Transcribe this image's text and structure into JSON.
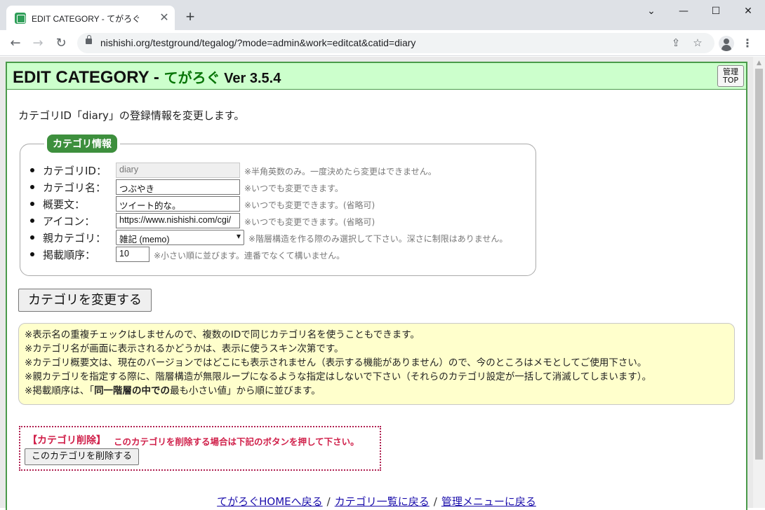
{
  "browser": {
    "tab_title": "EDIT CATEGORY - てがろぐ",
    "url": "nishishi.org/testground/tegalog/?mode=admin&work=editcat&catid=diary"
  },
  "header": {
    "title_main": "EDIT CATEGORY - ",
    "title_app": "てがろぐ",
    "title_version": " Ver 3.5.4",
    "admin_button_line1": "管理",
    "admin_button_line2": "TOP"
  },
  "intro": "カテゴリID「diary」の登録情報を変更します。",
  "form": {
    "legend": "カテゴリ情報",
    "fields": [
      {
        "label": "カテゴリID：",
        "value": "diary",
        "note": "※半角英数のみ。一度決めたら変更はできません。"
      },
      {
        "label": "カテゴリ名：",
        "value": "つぶやき",
        "note": "※いつでも変更できます。"
      },
      {
        "label": "概要文：",
        "value": "ツイート的な。",
        "note": "※いつでも変更できます。(省略可)"
      },
      {
        "label": "アイコン：",
        "value": "https://www.nishishi.com/cgi/",
        "note": "※いつでも変更できます。(省略可)"
      },
      {
        "label": "親カテゴリ：",
        "value": "雑記 (memo)",
        "note": "※階層構造を作る際のみ選択して下さい。深さに制限はありません。"
      },
      {
        "label": "掲載順序：",
        "value": "10",
        "note": "※小さい順に並びます。連番でなくて構いません。"
      }
    ],
    "submit_label": "カテゴリを変更する"
  },
  "notes": {
    "line1": "※表示名の重複チェックはしませんので、複数のIDで同じカテゴリ名を使うこともできます。",
    "line2": "※カテゴリ名が画面に表示されるかどうかは、表示に使うスキン次第です。",
    "line3": "※カテゴリ概要文は、現在のバージョンではどこにも表示されません（表示する機能がありません）ので、今のところはメモとしてご使用下さい。",
    "line4": "※親カテゴリを指定する際に、階層構造が無限ループになるような指定はしないで下さい（それらのカテゴリ設定が一括して消滅してしまいます）。",
    "line5_a": "※掲載順序は、「",
    "line5_b": "同一階層の中での",
    "line5_c": "最も小さい値」から順に並びます。"
  },
  "delete": {
    "title": "【カテゴリ削除】",
    "description": "このカテゴリを削除する場合は下記のボタンを押して下さい。",
    "button_label": "このカテゴリを削除する"
  },
  "footer": {
    "link_home": "てがろぐHOMEへ戻る",
    "link_categories": "カテゴリ一覧に戻る",
    "link_admin": "管理メニューに戻る",
    "separator": "/"
  }
}
